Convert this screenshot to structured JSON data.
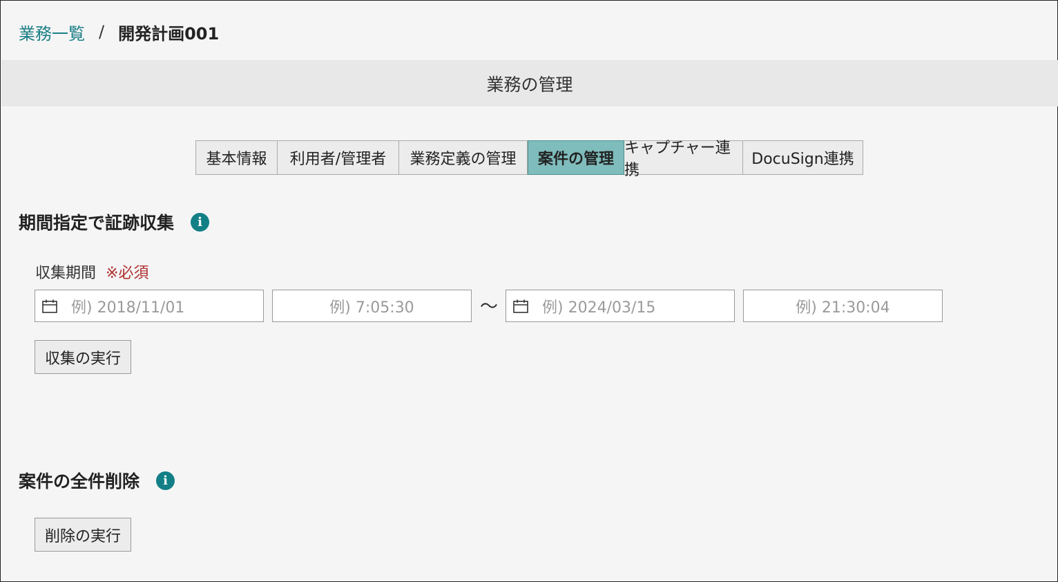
{
  "breadcrumb": {
    "parent": "業務一覧",
    "separator": "/",
    "current": "開発計画001"
  },
  "header": {
    "title": "業務の管理"
  },
  "tabs": [
    {
      "label": "基本情報",
      "active": false
    },
    {
      "label": "利用者/管理者",
      "active": false
    },
    {
      "label": "業務定義の管理",
      "active": false
    },
    {
      "label": "案件の管理",
      "active": true
    },
    {
      "label": "キャプチャー連携",
      "active": false
    },
    {
      "label": "DocuSign連携",
      "active": false
    }
  ],
  "collect_section": {
    "title": "期間指定で証跡収集",
    "period_label": "収集期間",
    "required_mark": "※必須",
    "start_date_placeholder": "例) 2018/11/01",
    "start_time_placeholder": "例) 7:05:30",
    "range_separator": "～",
    "end_date_placeholder": "例) 2024/03/15",
    "end_time_placeholder": "例) 21:30:04",
    "execute_label": "収集の実行"
  },
  "delete_section": {
    "title": "案件の全件削除",
    "execute_label": "削除の実行"
  },
  "colors": {
    "accent": "#127f86",
    "active_tab": "#7fbcbc",
    "required": "#b03030",
    "background": "#f5f5f5"
  },
  "icons": {
    "info": "info-icon",
    "calendar": "calendar-icon"
  }
}
